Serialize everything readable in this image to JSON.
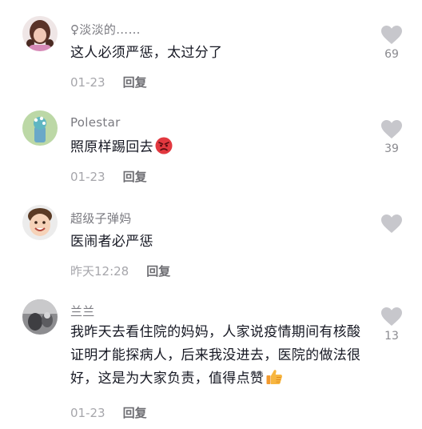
{
  "comments": [
    {
      "username": "♀淡淡的……",
      "text": "这人必须严惩，太过分了",
      "time": "01-23",
      "reply": "回复",
      "likes": "69",
      "avatar": "avatar-girl-braids"
    },
    {
      "username": "Polestar",
      "text": "照原样踢回去",
      "emoji": "angry-face-emoji",
      "time": "01-23",
      "reply": "回复",
      "likes": "39",
      "avatar": "avatar-cartoon-teal"
    },
    {
      "username": "超级子弹妈",
      "text": "医闹者必严惩",
      "time": "昨天12:28",
      "reply": "回复",
      "likes": "",
      "avatar": "avatar-smiling-child"
    },
    {
      "username": "兰兰",
      "text": "我昨天去看住院的妈妈，人家说疫情期间有核酸证明才能探病人，后来我没进去，医院的做法很好，这是为大家负责，值得点赞",
      "emoji": "thumbs-up-emoji",
      "time": "01-23",
      "reply": "回复",
      "likes": "13",
      "avatar": "avatar-gray-photo"
    }
  ],
  "colors": {
    "username": "#7a7a80",
    "text": "#161823",
    "time": "#a6a6ab",
    "reply": "#6e6e73",
    "heart": "#c7c7cc"
  }
}
